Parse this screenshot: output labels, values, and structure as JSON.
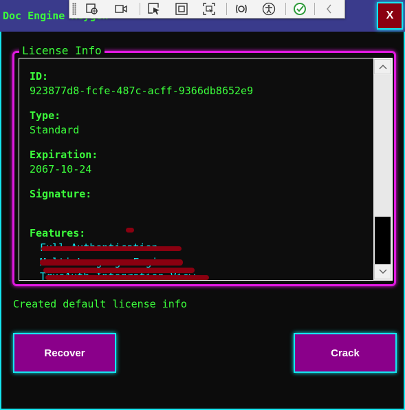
{
  "window": {
    "title": "Doc Engine Keygen",
    "close_label": "X"
  },
  "debug_toolbar": {
    "icons": [
      "grip-icon",
      "live-visual-tree-icon",
      "record-icon",
      "select-element-icon",
      "display-layout-adorners-icon",
      "track-focus-icon",
      "hot-reload-icon",
      "accessibility-icon",
      "binding-check-icon",
      "collapse-icon"
    ]
  },
  "license_panel": {
    "legend": "License Info",
    "id_label": "ID:",
    "id_value": "923877d8-fcfe-487c-acff-9366db8652e9",
    "type_label": "Type:",
    "type_value": "Standard",
    "expiration_label": "Expiration:",
    "expiration_value": "2067-10-24",
    "signature_label": "Signature:",
    "features_label": "Features:",
    "features": [
      "Full Authentication",
      "Multi-Language Engine",
      "TrueAuth Integration View"
    ]
  },
  "status": "Created default license info",
  "buttons": {
    "recover": "Recover",
    "crack": "Crack"
  },
  "colors": {
    "accent_green": "#3cff3c",
    "accent_cyan": "#14e6f0",
    "accent_magenta": "#e019e0",
    "button_purple": "#8a008a",
    "close_red": "#8a0010",
    "titlebar": "#3a3b8c"
  }
}
